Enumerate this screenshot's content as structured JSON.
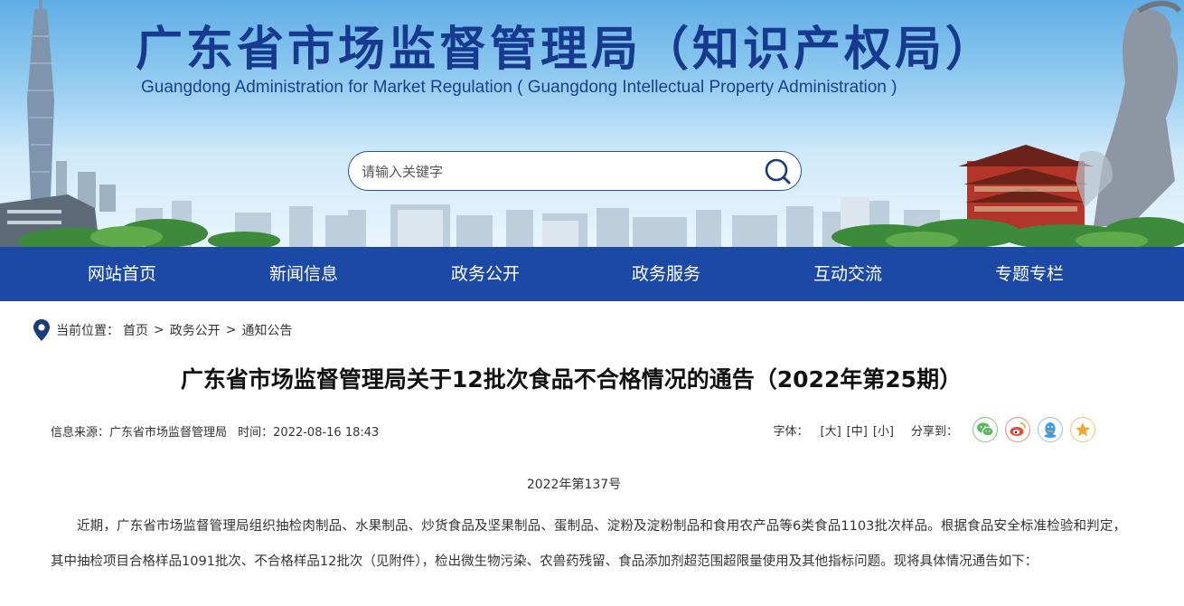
{
  "site": {
    "title": "广东省市场监督管理局（知识产权局）",
    "subtitle": "Guangdong Administration for Market Regulation ( Guangdong Intellectual Property Administration )"
  },
  "search": {
    "placeholder": "请输入关键字"
  },
  "nav": {
    "items": [
      {
        "label": "网站首页"
      },
      {
        "label": "新闻信息"
      },
      {
        "label": "政务公开"
      },
      {
        "label": "政务服务"
      },
      {
        "label": "互动交流"
      },
      {
        "label": "专题专栏"
      }
    ]
  },
  "breadcrumb": {
    "prefix": "当前位置：",
    "items": [
      "首页",
      "政务公开",
      "通知公告"
    ],
    "separator": ">"
  },
  "article": {
    "title": "广东省市场监督管理局关于12批次食品不合格情况的通告（2022年第25期）",
    "source": "信息来源：广东省市场监督管理局",
    "time": "时间：2022-08-16 18:43",
    "font_label": "字体：",
    "font_large": "[大]",
    "font_medium": "[中]",
    "font_small": "[小]",
    "share_label": "分享到：",
    "doc_number": "2022年第137号",
    "body": "近期，广东省市场监督管理局组织抽检肉制品、水果制品、炒货食品及坚果制品、蛋制品、淀粉及淀粉制品和食用农产品等6类食品1103批次样品。根据食品安全标准检验和判定，其中抽检项目合格样品1091批次、不合格样品12批次（见附件），检出微生物污染、农兽药残留、食品添加剂超范围超限量使用及其他指标问题。现将具体情况通告如下："
  },
  "colors": {
    "nav_bg": "#1c49a5",
    "title_blue": "#153a8e",
    "wechat": "#5cb85c",
    "weibo": "#e8473a",
    "qq": "#3d9be9",
    "fav": "#f0a92b"
  },
  "icons": [
    "search-icon",
    "location-pin-icon",
    "wechat-icon",
    "weibo-icon",
    "qq-icon",
    "favorite-star-icon"
  ]
}
